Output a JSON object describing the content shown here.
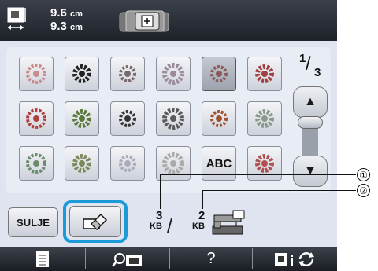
{
  "header": {
    "width_value": "9.6",
    "height_value": "9.3",
    "unit": "cm"
  },
  "pager": {
    "current": "1",
    "total": "3"
  },
  "grid": {
    "tiles": [
      "floral-round",
      "oval-floral",
      "round-rose",
      "square-lace",
      "square-star",
      "diamond-lace",
      "heart-wreath",
      "flower-cluster",
      "rose-bouquet",
      "lace-corner",
      "rose-single",
      "leaf-sprig",
      "oval-wreath",
      "flower-sprig",
      "vine-border",
      "horseshoe",
      "ABC",
      "flower-bouquet"
    ],
    "abc_label": "ABC",
    "selected_index": 4
  },
  "bottom": {
    "close_label": "SULJE",
    "left_memory": {
      "value": "3",
      "unit": "KB"
    },
    "right_memory": {
      "value": "2",
      "unit": "KB"
    }
  },
  "nav": {
    "items": [
      "page-icon",
      "magnifier-icon",
      "help-icon",
      "settings-icon"
    ],
    "help_label": "?"
  },
  "callouts": [
    "①",
    "②"
  ],
  "colors": {
    "highlight": "#1a9ad6",
    "topbar": "#2a2e36",
    "panel": "#dfe4f0"
  }
}
